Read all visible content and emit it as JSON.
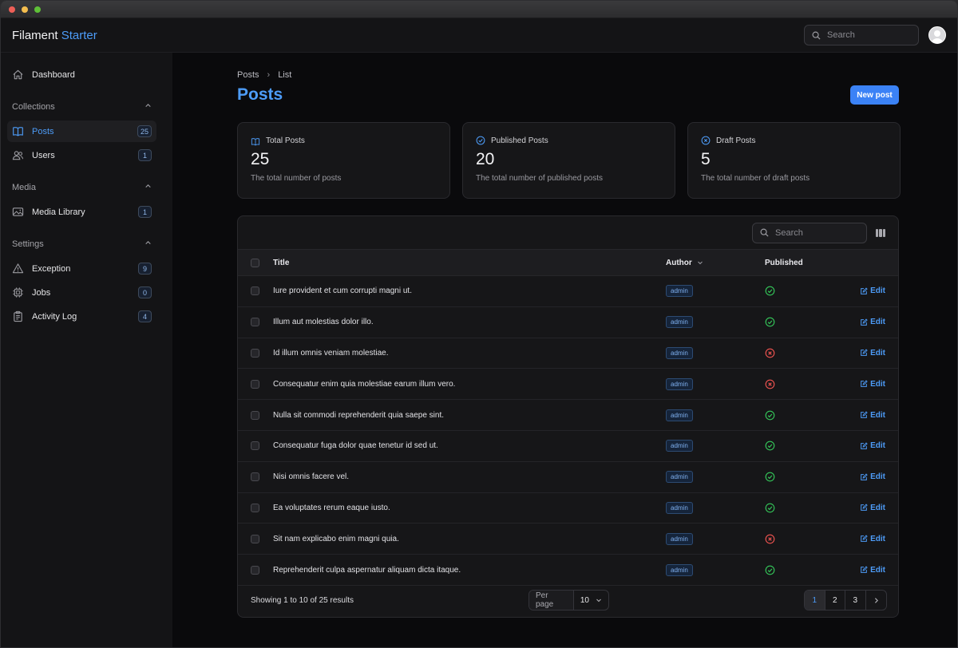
{
  "app": {
    "brand_part1": "Filament",
    "brand_part2": "Starter",
    "search_placeholder": "Search"
  },
  "window_controls": [
    {
      "name": "close",
      "color": "#ee5f57"
    },
    {
      "name": "minimize",
      "color": "#f5be4f"
    },
    {
      "name": "zoom",
      "color": "#5fc038"
    }
  ],
  "sidebar": {
    "dashboard": {
      "label": "Dashboard",
      "icon": "home-icon"
    },
    "groups": [
      {
        "label": "Collections",
        "items": [
          {
            "label": "Posts",
            "count": "25",
            "icon": "book-open-icon",
            "active": true
          },
          {
            "label": "Users",
            "count": "1",
            "icon": "users-icon",
            "active": false
          }
        ]
      },
      {
        "label": "Media",
        "items": [
          {
            "label": "Media Library",
            "count": "1",
            "icon": "photo-icon",
            "active": false
          }
        ]
      },
      {
        "label": "Settings",
        "items": [
          {
            "label": "Exception",
            "count": "9",
            "icon": "warning-icon",
            "active": false
          },
          {
            "label": "Jobs",
            "count": "0",
            "icon": "cpu-chip-icon",
            "active": false
          },
          {
            "label": "Activity Log",
            "count": "4",
            "icon": "clipboard-icon",
            "active": false
          }
        ]
      }
    ]
  },
  "header": {
    "breadcrumb": [
      "Posts",
      "List"
    ],
    "title": "Posts",
    "new_button": "New post"
  },
  "stats": [
    {
      "label": "Total Posts",
      "value": "25",
      "desc": "The total number of posts",
      "icon": "book-open-icon"
    },
    {
      "label": "Published Posts",
      "value": "20",
      "desc": "The total number of published posts",
      "icon": "check-circle-icon"
    },
    {
      "label": "Draft Posts",
      "value": "5",
      "desc": "The total number of draft posts",
      "icon": "x-circle-icon"
    }
  ],
  "table": {
    "search_placeholder": "Search",
    "columns": {
      "title": "Title",
      "author": "Author",
      "published": "Published"
    },
    "edit_label": "Edit",
    "rows": [
      {
        "title": "Iure provident et cum corrupti magni ut.",
        "author": "admin",
        "published": true
      },
      {
        "title": "Illum aut molestias dolor illo.",
        "author": "admin",
        "published": true
      },
      {
        "title": "Id illum omnis veniam molestiae.",
        "author": "admin",
        "published": false
      },
      {
        "title": "Consequatur enim quia molestiae earum illum vero.",
        "author": "admin",
        "published": false
      },
      {
        "title": "Nulla sit commodi reprehenderit quia saepe sint.",
        "author": "admin",
        "published": true
      },
      {
        "title": "Consequatur fuga dolor quae tenetur id sed ut.",
        "author": "admin",
        "published": true
      },
      {
        "title": "Nisi omnis facere vel.",
        "author": "admin",
        "published": true
      },
      {
        "title": "Ea voluptates rerum eaque iusto.",
        "author": "admin",
        "published": true
      },
      {
        "title": "Sit nam explicabo enim magni quia.",
        "author": "admin",
        "published": false
      },
      {
        "title": "Reprehenderit culpa aspernatur aliquam dicta itaque.",
        "author": "admin",
        "published": true
      }
    ],
    "footer": {
      "summary": "Showing 1 to 10 of 25 results",
      "per_page_label": "Per page",
      "per_page_value": "10",
      "pages": [
        "1",
        "2",
        "3"
      ],
      "current_page": "1"
    }
  },
  "colors": {
    "accent": "#4d9cf8",
    "success": "#34c759",
    "danger": "#ef5350"
  }
}
